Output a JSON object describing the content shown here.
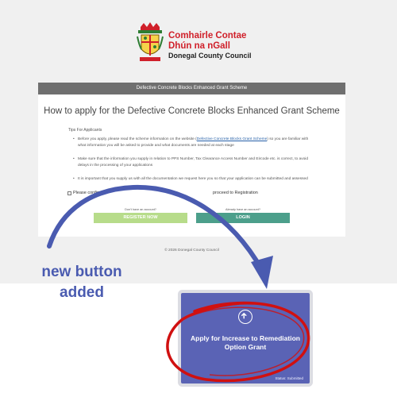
{
  "logo": {
    "line1": "Comhairle Contae",
    "line2": "Dhún na nGall",
    "line3": "Donegal County Council"
  },
  "header": {
    "title": "Defective Concrete Blocks Enhanced Grant Scheme"
  },
  "page": {
    "title": "How to apply for the Defective Concrete Blocks Enhanced Grant Scheme",
    "tips_label": "Tips For Applicants",
    "bullets": {
      "b1_before": "Before you apply, please read the scheme information on the website (",
      "b1_link": "Defective Concrete Blocks Grant Scheme",
      "b1_after": ") so you are familiar with what information you will be asked to provide and what documents are needed at each stage",
      "b2": "Make sure that the information you supply in relation to PPS Number, Tax Clearance Access Number and Eircode etc. is correct, to avoid delays in the processing of your applications",
      "b3": "It is important that you supply us with all the documentation we request here you so that your application can be submitted and assessed"
    },
    "confirm_text": "Please confirm",
    "confirm_text_2": "proceed to Registration",
    "no_account_label": "Don't have an account?",
    "has_account_label": "Already have an account?",
    "register_label": "REGISTER NOW",
    "login_label": "LOGIN"
  },
  "footer": {
    "copyright": "© 2026 Donegal County Council"
  },
  "annotation": {
    "line1": "new button",
    "line2": "added"
  },
  "apply_card": {
    "title": "Apply for Increase to Remediation Option Grant",
    "status": "Status: Submitted",
    "icon": "arrow-up-circle-icon"
  },
  "colors": {
    "logo_red": "#d0202a",
    "header_bar": "#6f6f6f",
    "register_green": "#b7dc8a",
    "login_teal": "#4c9f8b",
    "apply_purple": "#5a63b5",
    "arrow_blue": "#4a5bb0",
    "circle_red": "#d01010"
  }
}
